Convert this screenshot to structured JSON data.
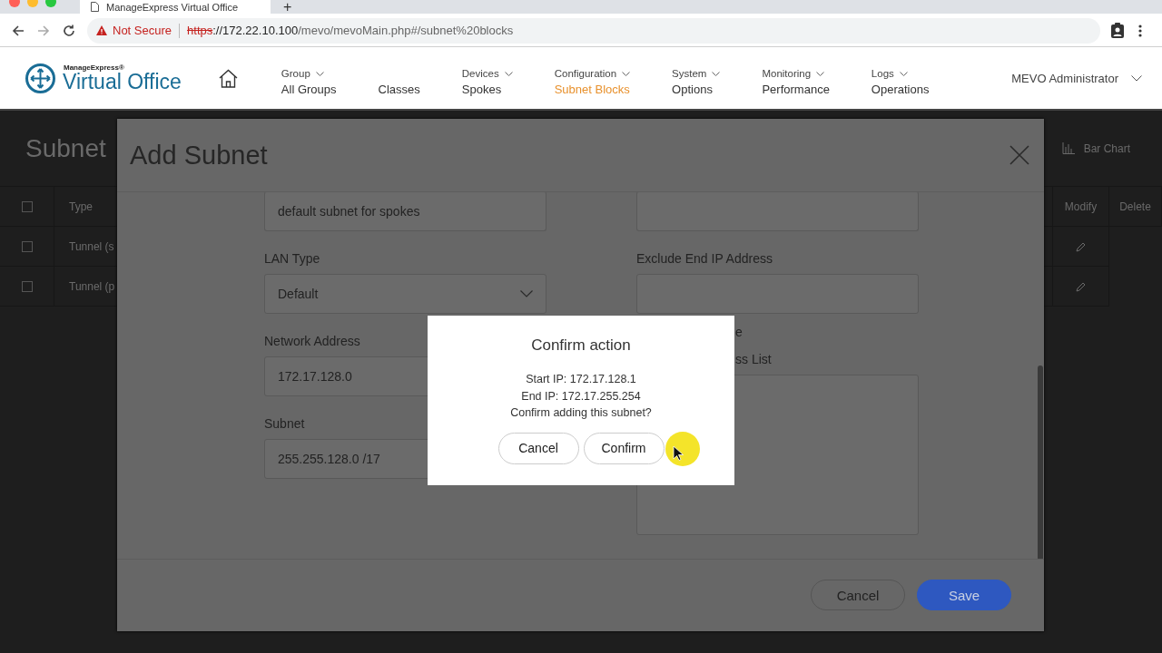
{
  "browser": {
    "tab_title": "ManageExpress Virtual Office",
    "new_tab": "+",
    "security": "Not Secure",
    "url_scheme": "https",
    "url_host": "://172.22.10.100",
    "url_path": "/mevo/mevoMain.php#/subnet%20blocks"
  },
  "app": {
    "logo_small": "ManageExpress®",
    "logo_big": "Virtual Office",
    "nav": [
      {
        "category": "Group",
        "label": "All Groups",
        "selected": false
      },
      {
        "label": "Classes",
        "selected": false
      },
      {
        "category": "Devices",
        "label": "Spokes",
        "selected": false
      },
      {
        "category": "Configuration",
        "label": "Subnet Blocks",
        "selected": true
      },
      {
        "category": "System",
        "label": "Options",
        "selected": false
      },
      {
        "category": "Monitoring",
        "label": "Performance",
        "selected": false
      },
      {
        "category": "Logs",
        "label": "Operations",
        "selected": false
      }
    ],
    "user": "MEVO Administrator"
  },
  "background_page": {
    "title": "Subnet",
    "view_label": "Bar Chart",
    "columns": [
      "Type",
      "Modify",
      "Delete"
    ],
    "header_checked": false,
    "rows": [
      {
        "type": "Tunnel (s",
        "checked": false
      },
      {
        "type": "Tunnel (p",
        "checked": false
      }
    ]
  },
  "modal": {
    "title": "Add Subnet",
    "left_column": [
      {
        "kind": "input",
        "value": "default subnet for spokes"
      },
      {
        "kind": "label",
        "text": "LAN Type"
      },
      {
        "kind": "select",
        "value": "Default"
      },
      {
        "kind": "label",
        "text": "Network Address"
      },
      {
        "kind": "input",
        "value": "172.17.128.0"
      },
      {
        "kind": "label",
        "text": "Subnet"
      },
      {
        "kind": "input",
        "value": "255.255.128.0 /17"
      }
    ],
    "right_column": [
      {
        "kind": "input"
      },
      {
        "kind": "label",
        "text": "Exclude End IP Address"
      },
      {
        "kind": "input"
      },
      {
        "kind": "clipped_label",
        "text": "e"
      },
      {
        "kind": "clipped_label",
        "text": "ss List"
      },
      {
        "kind": "textarea"
      }
    ],
    "buttons": [
      {
        "kind": "secondary",
        "label": "Cancel"
      },
      {
        "kind": "primary",
        "label": "Save"
      }
    ]
  },
  "dialog": {
    "title": "Confirm action",
    "lines": [
      "Start IP: 172.17.128.1",
      "End IP: 172.17.255.254",
      "Confirm adding this subnet?"
    ],
    "buttons": [
      {
        "label": "Cancel"
      },
      {
        "label": "Confirm"
      }
    ]
  }
}
